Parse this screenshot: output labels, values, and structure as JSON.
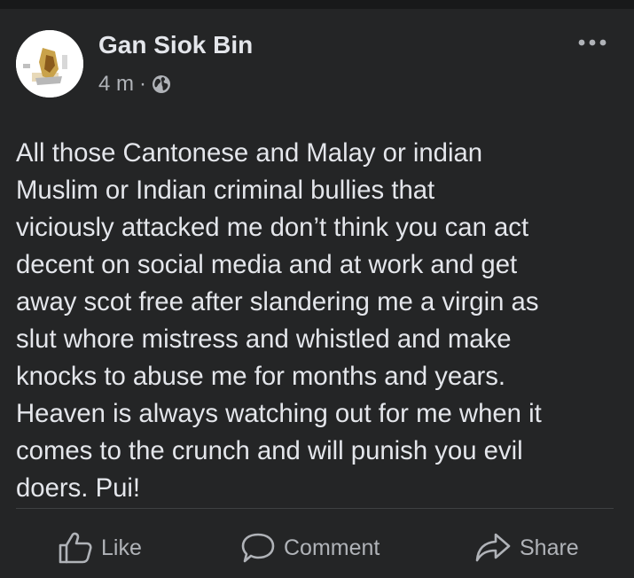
{
  "post": {
    "author": "Gan Siok Bin",
    "time": "4 m",
    "separator": "·",
    "privacy_icon": "globe-icon",
    "menu_icon": "more-options-icon",
    "text": "All those Cantonese and Malay or indian\nMuslim or Indian criminal bullies that\nviciously attacked me don’t think you can act\ndecent on social media and at work and get\naway scot free after slandering me a virgin as\nslut whore mistress and whistled and make\nknocks to abuse me for months and years.\nHeaven is always watching out for me when it\ncomes to the crunch and will punish you evil\ndoers. Pui!"
  },
  "actions": {
    "like_label": "Like",
    "comment_label": "Comment",
    "share_label": "Share"
  },
  "colors": {
    "background": "#18191a",
    "card": "#242526",
    "primary_text": "#e4e6eb",
    "secondary_text": "#b0b3b8",
    "divider": "#3e4042"
  }
}
